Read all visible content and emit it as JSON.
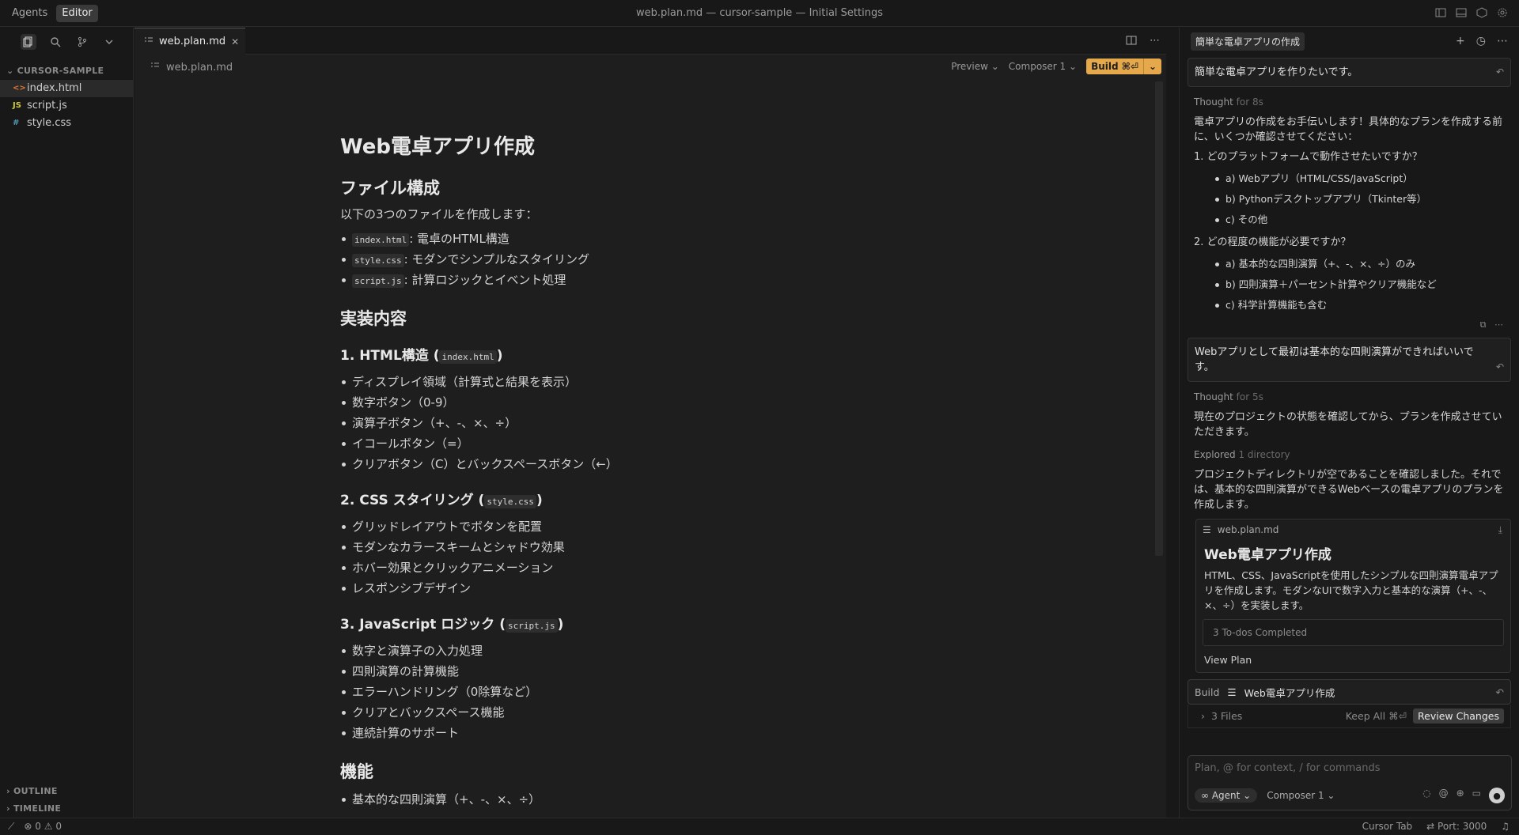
{
  "titlebar": {
    "tabs": [
      "Agents",
      "Editor"
    ],
    "title": "web.plan.md — cursor-sample — Initial Settings"
  },
  "sidebar": {
    "section": "CURSOR-SAMPLE",
    "files": [
      {
        "name": "index.html",
        "icon": "html-file-icon",
        "glyph": "<>"
      },
      {
        "name": "script.js",
        "icon": "js-file-icon",
        "glyph": "JS"
      },
      {
        "name": "style.css",
        "icon": "css-file-icon",
        "glyph": "#"
      }
    ],
    "outline": "OUTLINE",
    "timeline": "TIMELINE"
  },
  "editor": {
    "tab": "web.plan.md",
    "breadcrumb": "web.plan.md",
    "preview": "Preview",
    "composer": "Composer 1",
    "build": "Build ⌘⏎",
    "doc": {
      "h1": "Web電卓アプリ作成",
      "files_h": "ファイル構成",
      "files_intro": "以下の3つのファイルを作成します：",
      "files": [
        {
          "code": "index.html",
          "text": ": 電卓のHTML構造"
        },
        {
          "code": "style.css",
          "text": ": モダンでシンプルなスタイリング"
        },
        {
          "code": "script.js",
          "text": ": 計算ロジックとイベント処理"
        }
      ],
      "impl_h": "実装内容",
      "sec1_title": "1. HTML構造 (",
      "sec1_code": "index.html",
      "sec1_items": [
        "ディスプレイ領域（計算式と結果を表示）",
        "数字ボタン（0-9）",
        "演算子ボタン（+、-、×、÷）",
        "イコールボタン（=）",
        "クリアボタン（C）とバックスペースボタン（←）"
      ],
      "sec2_title": "2. CSS スタイリング (",
      "sec2_code": "style.css",
      "sec2_items": [
        "グリッドレイアウトでボタンを配置",
        "モダンなカラースキームとシャドウ効果",
        "ホバー効果とクリックアニメーション",
        "レスポンシブデザイン"
      ],
      "sec3_title": "3. JavaScript ロジック (",
      "sec3_code": "script.js",
      "sec3_items": [
        "数字と演算子の入力処理",
        "四則演算の計算機能",
        "エラーハンドリング（0除算など）",
        "クリアとバックスペース機能",
        "連続計算のサポート"
      ],
      "features_h": "機能",
      "features_items": [
        "基本的な四則演算（+、-、×、÷）"
      ]
    }
  },
  "chat": {
    "title": "簡単な電卓アプリの作成",
    "msg1": "簡単な電卓アプリを作りたいです。",
    "thought1": "Thought",
    "thought1_time": "for 8s",
    "reply1": "電卓アプリの作成をお手伝いします！具体的なプランを作成する前に、いくつか確認させてください：",
    "q1": "1. どのプラットフォームで動作させたいですか？",
    "q1_opts": [
      "a) Webアプリ（HTML/CSS/JavaScript）",
      "b) Pythonデスクトップアプリ（Tkinter等）",
      "c) その他"
    ],
    "q2": "2. どの程度の機能が必要ですか？",
    "q2_opts": [
      "a) 基本的な四則演算（+、-、×、÷）のみ",
      "b) 四則演算＋パーセント計算やクリア機能など",
      "c) 科学計算機能も含む"
    ],
    "msg2": "Webアプリとして最初は基本的な四則演算ができればいいです。",
    "thought2": "Thought",
    "thought2_time": "for 5s",
    "reply2": "現在のプロジェクトの状態を確認してから、プランを作成させていただきます。",
    "explored": "Explored",
    "explored_detail": "1 directory",
    "reply3": "プロジェクトディレクトリが空であることを確認しました。それでは、基本的な四則演算ができるWebベースの電卓アプリのプランを作成します。",
    "plan": {
      "file": "web.plan.md",
      "title": "Web電卓アプリ作成",
      "desc": "HTML、CSS、JavaScriptを使用したシンプルな四則演算電卓アプリを作成します。モダンなUIで数字入力と基本的な演算（+、-、×、÷）を実装します。",
      "todos": "3 To-dos Completed",
      "view": "View Plan"
    },
    "build_label": "Build",
    "build_title": "Web電卓アプリ作成",
    "files_count": "3 Files",
    "keep_all": "Keep All ⌘⏎",
    "review": "Review Changes",
    "input_placeholder": "Plan, @ for context, / for commands",
    "agent": "Agent",
    "composer": "Composer 1"
  },
  "status": {
    "errors": "0",
    "warnings": "0",
    "cursor_tab": "Cursor Tab",
    "port": "Port: 3000"
  }
}
